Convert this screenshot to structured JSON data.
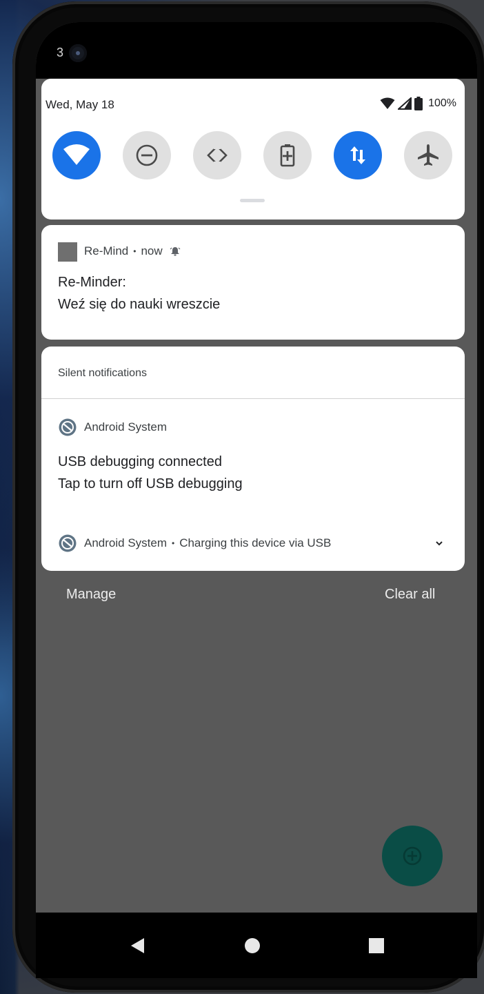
{
  "status_bar": {
    "clock_partial": "3"
  },
  "quick_settings": {
    "date": "Wed, May 18",
    "battery_percent": "100%",
    "tiles": [
      {
        "name": "Wi-Fi",
        "icon": "wifi-icon",
        "active": true
      },
      {
        "name": "Do Not Disturb",
        "icon": "do-not-disturb-icon",
        "active": false
      },
      {
        "name": "Auto-rotate",
        "icon": "auto-rotate-icon",
        "active": false
      },
      {
        "name": "Battery Saver",
        "icon": "battery-saver-icon",
        "active": false
      },
      {
        "name": "Mobile data",
        "icon": "mobile-data-icon",
        "active": true
      },
      {
        "name": "Airplane mode",
        "icon": "airplane-icon",
        "active": false
      }
    ],
    "colors": {
      "active": "#1a73e8",
      "inactive": "#e0e0e0"
    }
  },
  "notifications": {
    "remind": {
      "app_name": "Re-Mind",
      "time": "now",
      "title": "Re-Minder:",
      "body": "Weź się do nauki wreszcie"
    },
    "silent_section_label": "Silent notifications",
    "usb": {
      "app_name": "Android System",
      "title": "USB debugging connected",
      "body": "Tap to turn off USB debugging"
    },
    "charging": {
      "app_name": "Android System",
      "text": "Charging this device via USB"
    }
  },
  "footer": {
    "manage_label": "Manage",
    "clear_all_label": "Clear all"
  },
  "fab": {
    "icon": "add-circle-icon",
    "color": "#0a4d46"
  },
  "nav": {
    "back": "back-icon",
    "home": "home-icon",
    "recents": "recents-icon"
  }
}
